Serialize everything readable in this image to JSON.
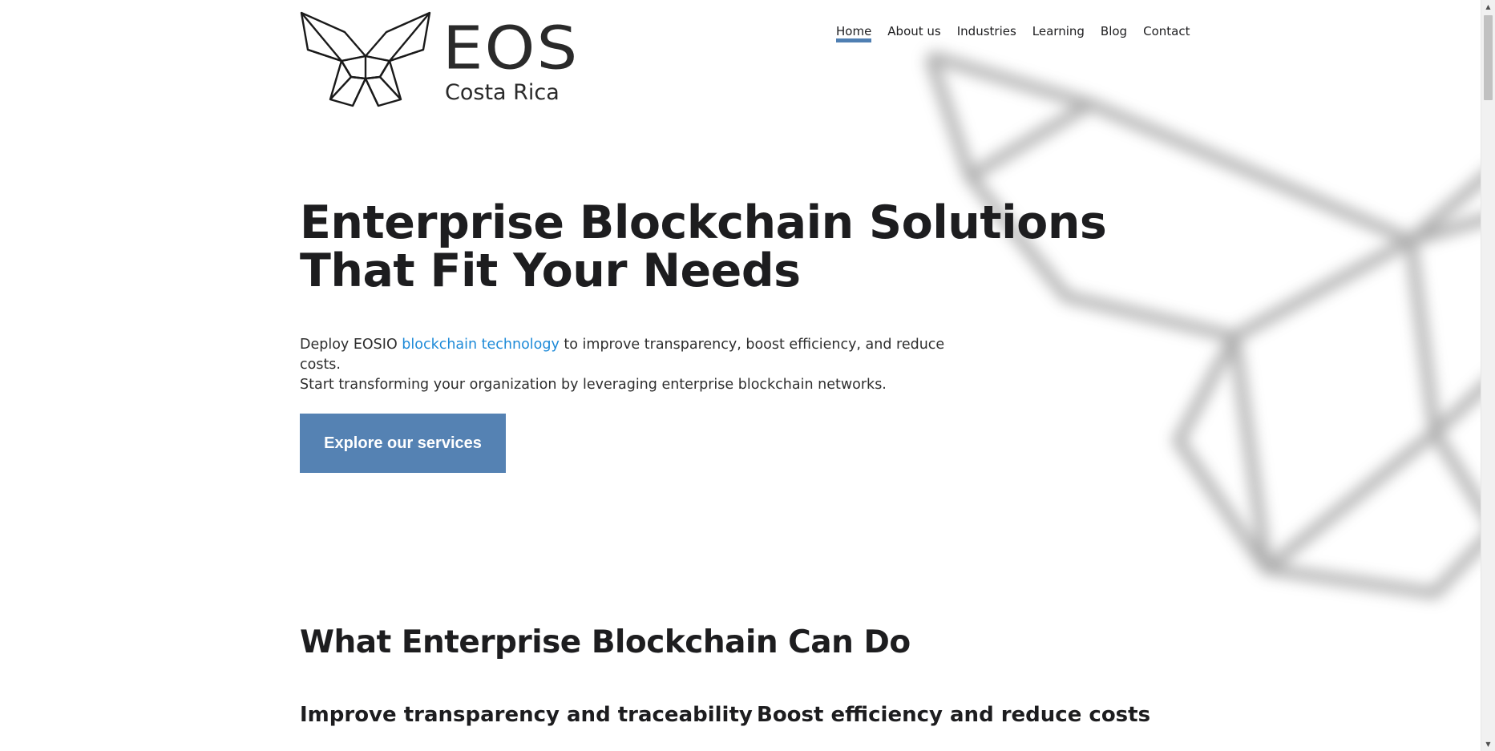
{
  "brand": {
    "name": "EOS",
    "subtitle": "Costa Rica",
    "logo_icon": "butterfly-icon"
  },
  "nav": {
    "items": [
      {
        "label": "Home",
        "active": true
      },
      {
        "label": "About us",
        "active": false
      },
      {
        "label": "Industries",
        "active": false
      },
      {
        "label": "Learning",
        "active": false
      },
      {
        "label": "Blog",
        "active": false
      },
      {
        "label": "Contact",
        "active": false
      }
    ]
  },
  "hero": {
    "title_line1": "Enterprise Blockchain Solutions",
    "title_line2": "That Fit Your Needs",
    "text_before_link": "Deploy EOSIO ",
    "link_text": "blockchain technology",
    "text_after_link": " to improve transparency, boost efficiency, and reduce costs.",
    "text_line2": "Start transforming your organization by leveraging enterprise blockchain networks.",
    "cta_label": "Explore our services"
  },
  "section": {
    "title": "What Enterprise Blockchain Can Do",
    "features": [
      {
        "title": "Improve transparency and traceability"
      },
      {
        "title": "Boost efficiency and reduce costs"
      }
    ]
  },
  "colors": {
    "accent": "#4f7fb2",
    "button": "#5582b3",
    "link": "#1d8ad8",
    "text": "#1d1d1f"
  }
}
